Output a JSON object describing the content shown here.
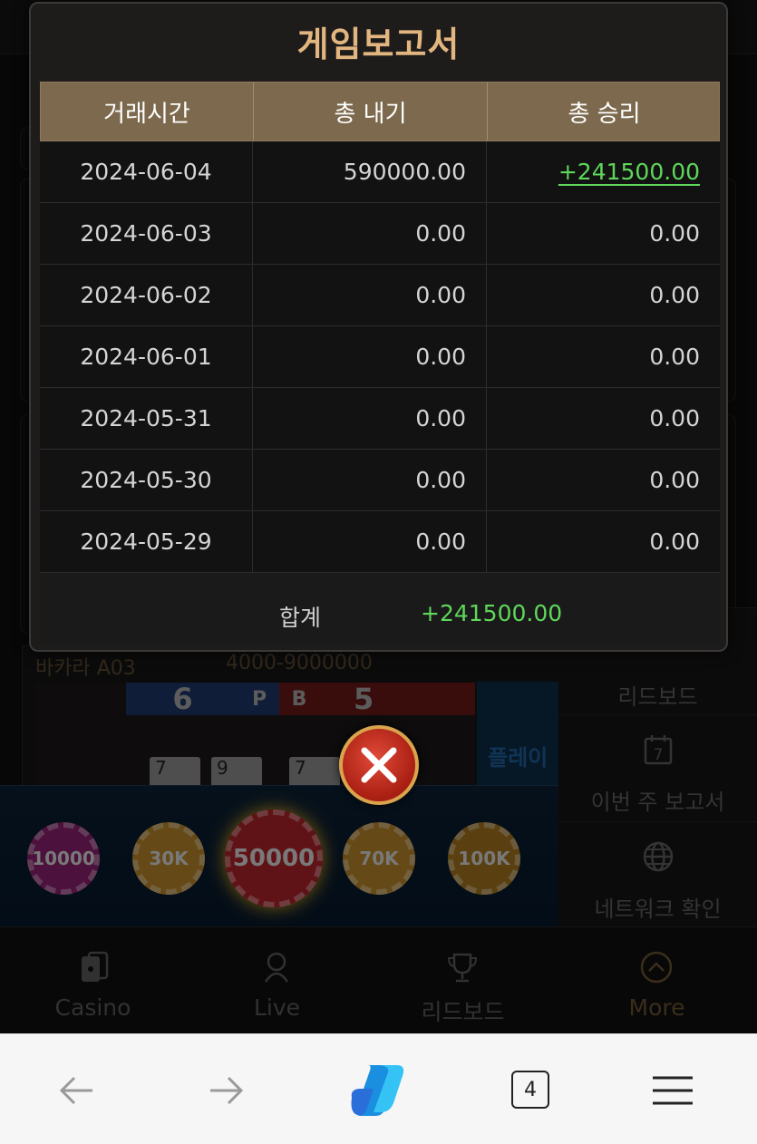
{
  "report": {
    "title": "게임보고서",
    "headers": [
      "거래시간",
      "총 내기",
      "총 승리"
    ],
    "rows": [
      {
        "date": "2024-06-04",
        "bet": "590000.00",
        "win": "+241500.00"
      },
      {
        "date": "2024-06-03",
        "bet": "0.00",
        "win": "0.00"
      },
      {
        "date": "2024-06-02",
        "bet": "0.00",
        "win": "0.00"
      },
      {
        "date": "2024-06-01",
        "bet": "0.00",
        "win": "0.00"
      },
      {
        "date": "2024-05-31",
        "bet": "0.00",
        "win": "0.00"
      },
      {
        "date": "2024-05-30",
        "bet": "0.00",
        "win": "0.00"
      },
      {
        "date": "2024-05-29",
        "bet": "0.00",
        "win": "0.00"
      }
    ],
    "total_label": "합계",
    "total_value": "+241500.00",
    "close_icon": "close-x-icon"
  },
  "background": {
    "game_name": "바카라 A03",
    "game_limit": "4000-9000000",
    "road_banker_count": "6",
    "road_player_label": "P",
    "road_banker_label": "B",
    "road_tie_count": "5",
    "cards": [
      "7",
      "9",
      "7"
    ],
    "player_button_partial": "플레이",
    "chips": [
      {
        "label": "10000",
        "color": "#8a1f6d"
      },
      {
        "label": "30K",
        "color": "#b8862a"
      },
      {
        "label": "50000",
        "color": "#b0232a"
      },
      {
        "label": "70K",
        "color": "#b8862a"
      },
      {
        "label": "100K",
        "color": "#a5761e"
      }
    ],
    "side_menu": [
      {
        "label": "리드보드",
        "icon": "leaderboard-icon"
      },
      {
        "label": "이번 주 보고서",
        "icon": "calendar-7-icon",
        "icon_text": "7"
      },
      {
        "label": "네트워크 확인",
        "icon": "globe-icon"
      }
    ],
    "bottom_nav": [
      {
        "label": "Casino",
        "icon": "cards-icon"
      },
      {
        "label": "Live",
        "icon": "dealer-icon"
      },
      {
        "label": "리드보드",
        "icon": "trophy-icon"
      },
      {
        "label": "More",
        "icon": "chevron-up-circle-icon"
      }
    ]
  },
  "browser": {
    "back_icon": "arrow-left-icon",
    "forward_icon": "arrow-right-icon",
    "copilot_icon": "copilot-icon",
    "tab_count": "4",
    "menu_icon": "hamburger-menu-icon"
  },
  "colors": {
    "title_gold": "#e3b680",
    "header_bg": "#7d6a4e",
    "win_green": "#5fd75a",
    "close_red": "#c0291c"
  }
}
